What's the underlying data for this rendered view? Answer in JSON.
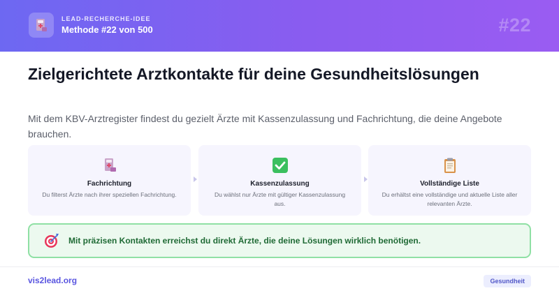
{
  "header": {
    "eyebrow": "LEAD-RECHERCHE-IDEE",
    "method": "Methode #22 von 500",
    "number": "#22",
    "logo_icon": "doctor-register-icon"
  },
  "main": {
    "title": "Zielgerichtete Arztkontakte für deine Gesundheitslösungen",
    "lead": "Mit dem KBV-Arztregister findest du gezielt Ärzte mit Kassenzulassung und Fachrichtung, die deine Angebote brauchen."
  },
  "cards": [
    {
      "icon": "register-icon",
      "title": "Fachrichtung",
      "text": "Du filterst Ärzte nach ihrer speziellen Fachrichtung."
    },
    {
      "icon": "check-icon",
      "title": "Kassenzulassung",
      "text": "Du wählst nur Ärzte mit gültiger Kassenzulassung aus."
    },
    {
      "icon": "clipboard-icon",
      "title": "Vollständige Liste",
      "text": "Du erhältst eine vollständige und aktuelle Liste aller relevanten Ärzte."
    }
  ],
  "benefit": {
    "icon": "target-icon",
    "text": "Mit präzisen Kontakten erreichst du direkt Ärzte, die deine Lösungen wirklich benötigen."
  },
  "footer": {
    "site": "vis2lead.org",
    "tag": "Gesundheit"
  },
  "colors": {
    "header_start": "#6d68f2",
    "header_end": "#9a5cf2",
    "card_bg": "#f6f5fe",
    "benefit_bg": "#ecf9ef",
    "benefit_border": "#8fe0a4",
    "benefit_text": "#1f6a35",
    "brand": "#5a56e0"
  }
}
